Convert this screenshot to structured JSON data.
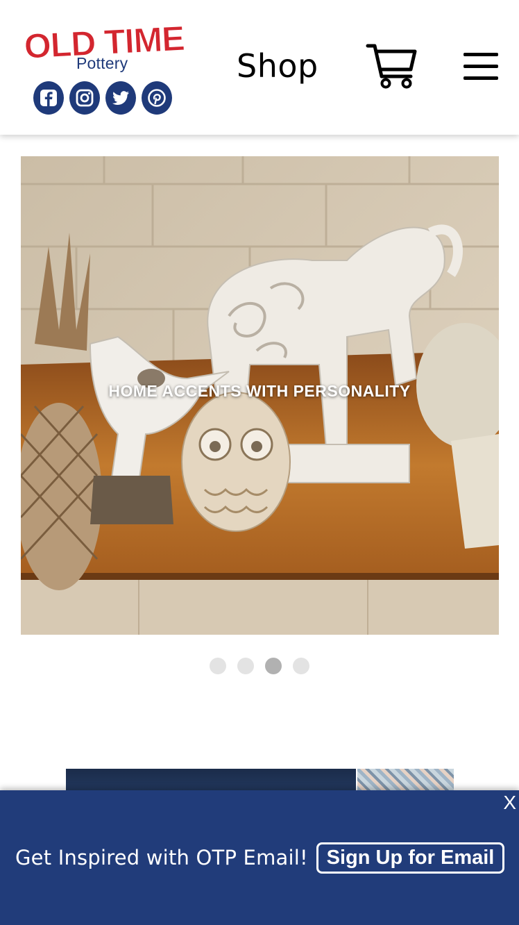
{
  "header": {
    "logo_title": "OLD TIME",
    "logo_subtitle": "Pottery",
    "social_icons": [
      "facebook-icon",
      "instagram-icon",
      "twitter-icon",
      "pinterest-icon"
    ],
    "shop_label": "Shop",
    "cart_icon": "cart-icon",
    "menu_icon": "hamburger-menu-icon"
  },
  "hero": {
    "caption": "HOME ACCENTS WITH PERSONALITY",
    "slides_count": 4,
    "active_slide": 3
  },
  "email_bar": {
    "close_label": "X",
    "promo_text": "Get Inspired with OTP Email!",
    "signup_label": "Sign Up for Email"
  },
  "colors": {
    "brand_red": "#d3262f",
    "brand_navy": "#213c7a",
    "dot_inactive": "#e3e3e3",
    "dot_active": "#b1b1b1"
  }
}
